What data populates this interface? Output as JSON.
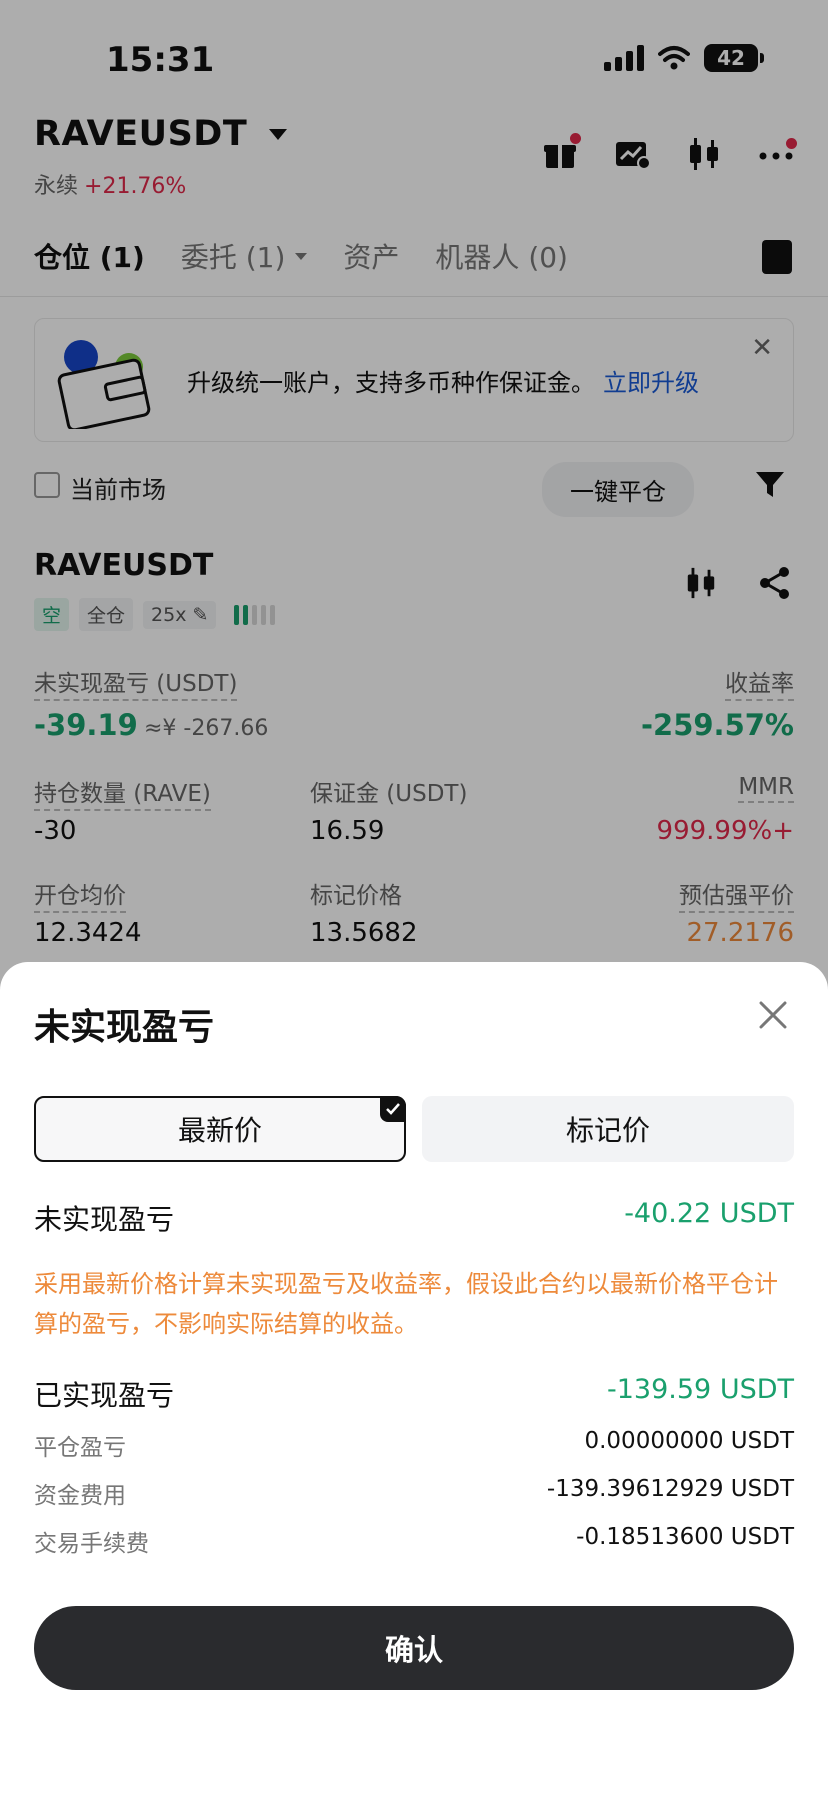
{
  "status_bar": {
    "time": "15:31",
    "battery": "42"
  },
  "header": {
    "pair": "RAVEUSDT",
    "contract_type": "永续",
    "change": "+21.76%"
  },
  "tabs": [
    {
      "label": "仓位 (1)"
    },
    {
      "label": "委托 (1)"
    },
    {
      "label": "资产"
    },
    {
      "label": "机器人 (0)"
    }
  ],
  "banner": {
    "text": "升级统一账户，支持多币种作保证金。",
    "link": "立即升级"
  },
  "filter": {
    "current_market": "当前市场",
    "close_all": "一键平仓"
  },
  "position": {
    "symbol": "RAVEUSDT",
    "tags": {
      "side": "空",
      "margin_mode": "全仓",
      "leverage": "25x"
    },
    "unrealized_label": "未实现盈亏 (USDT)",
    "unrealized_value": "-39.19",
    "unrealized_cny": "≈¥ -267.66",
    "roe_label": "收益率",
    "roe_value": "-259.57%",
    "qty_label": "持仓数量 (RAVE)",
    "qty_value": "-30",
    "margin_label": "保证金 (USDT)",
    "margin_value": "16.59",
    "mmr_label": "MMR",
    "mmr_value": "999.99%+",
    "entry_label": "开仓均价",
    "entry_value": "12.3424",
    "mark_label": "标记价格",
    "mark_value": "13.5682",
    "liq_label": "预估强平价",
    "liq_value": "27.2176"
  },
  "sheet": {
    "title": "未实现盈亏",
    "segments": {
      "latest": "最新价",
      "mark": "标记价"
    },
    "unrealized_label": "未实现盈亏",
    "unrealized_value": "-40.22 USDT",
    "note": "采用最新价格计算未实现盈亏及收益率，假设此合约以最新价格平仓计算的盈亏，不影响实际结算的收益。",
    "realized_label": "已实现盈亏",
    "realized_value": "-139.59 USDT",
    "close_pnl_label": "平仓盈亏",
    "close_pnl_value": "0.00000000 USDT",
    "funding_label": "资金费用",
    "funding_value": "-139.39612929 USDT",
    "fee_label": "交易手续费",
    "fee_value": "-0.18513600 USDT",
    "confirm": "确认"
  },
  "colors": {
    "green": "#1aa06d",
    "red": "#e0294a",
    "orange": "#ed8a3b",
    "link": "#1a5bd6"
  },
  "icons": [
    "gift-icon",
    "chart-edit-icon",
    "candlestick-icon",
    "more-icon",
    "document-icon",
    "wallet-illustration",
    "filter-icon",
    "share-icon",
    "close-icon",
    "check-icon",
    "edit-icon"
  ]
}
